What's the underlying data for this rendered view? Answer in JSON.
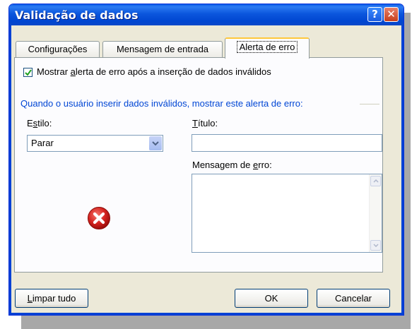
{
  "window": {
    "title": "Validação de dados",
    "help_button": "?",
    "close_button": "✕"
  },
  "tabs": [
    {
      "label": "Configurações",
      "selected": false
    },
    {
      "label": "Mensagem de entrada",
      "selected": false
    },
    {
      "label": "Alerta de erro",
      "selected": true
    }
  ],
  "alert": {
    "checkbox_label_pre": "Mostrar ",
    "checkbox_label_accel": "a",
    "checkbox_label_post": "lerta de erro após a inserção de dados inválidos",
    "checkbox_checked": true,
    "group_title": "Quando o usuário inserir dados inválidos, mostrar este alerta de erro:",
    "style_label_pre": "E",
    "style_label_accel": "s",
    "style_label_post": "tilo:",
    "style_value": "Parar",
    "title_label_accel": "T",
    "title_label_post": "ítulo:",
    "title_value": "",
    "message_label_pre": "Mensagem de ",
    "message_label_accel": "e",
    "message_label_post": "rro:",
    "message_value": ""
  },
  "buttons": {
    "clear_accel": "L",
    "clear_post": "impar tudo",
    "ok": "OK",
    "cancel": "Cancelar"
  },
  "colors": {
    "titlebar": "#0054e3",
    "group_title": "#0046d5",
    "error_icon": "#d4231f",
    "active_tab_highlight": "#ffc83c"
  },
  "icons": {
    "error": "error-x-circle-icon",
    "dropdown": "chevron-down-icon"
  }
}
